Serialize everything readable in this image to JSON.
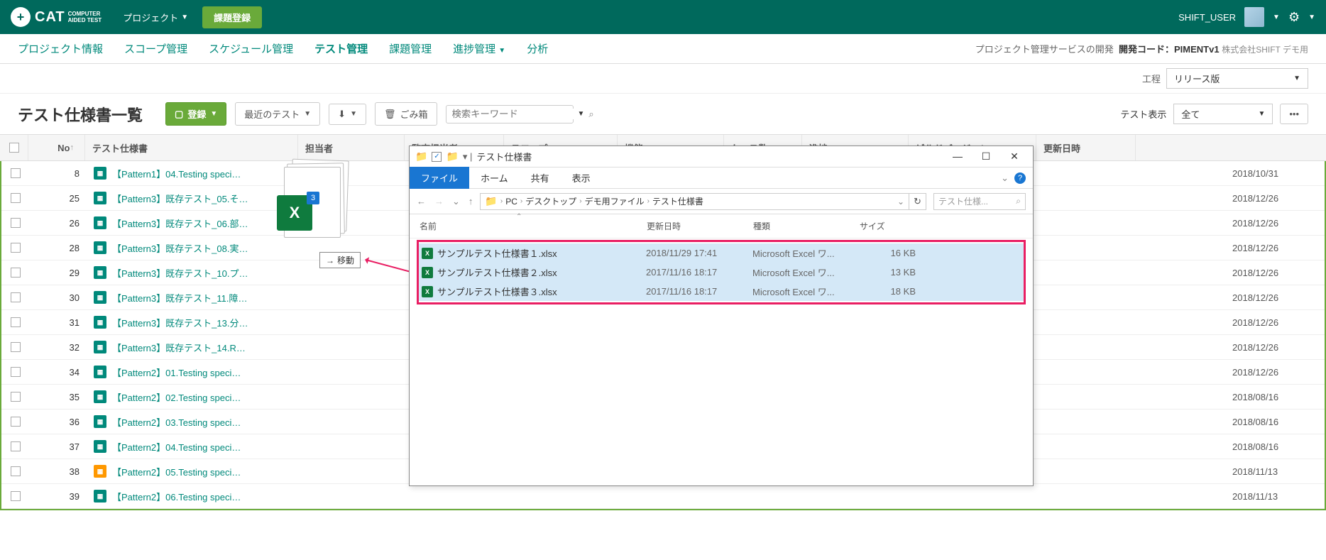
{
  "topbar": {
    "logo_main": "CAT",
    "logo_sub1": "COMPUTER",
    "logo_sub2": "AIDED TEST",
    "project_menu": "プロジェクト",
    "register_btn": "課題登録",
    "user": "SHIFT_USER"
  },
  "subnav": {
    "items": [
      "プロジェクト情報",
      "スコープ管理",
      "スケジュール管理",
      "テスト管理",
      "課題管理",
      "進捗管理",
      "分析"
    ],
    "dropdown_idx": 5,
    "active_idx": 3,
    "right_label": "プロジェクト管理サービスの開発",
    "dev_code_label": "開発コード：",
    "dev_code": "PIMENTv1",
    "company": "株式会社SHIFT デモ用"
  },
  "filter": {
    "label": "工程",
    "value": "リリース版"
  },
  "page": {
    "title": "テスト仕様書一覧",
    "register_btn": "登録",
    "recent_btn": "最近のテスト",
    "trash_btn": "ごみ箱",
    "search_placeholder": "検索キーワード",
    "display_label": "テスト表示",
    "display_value": "全て"
  },
  "columns": {
    "no": "No",
    "name": "テスト仕様書",
    "assign": "担当者",
    "audit": "監査担当者",
    "scope": "スコープ",
    "func": "機能",
    "cases": "ケース数",
    "progress": "進捗",
    "build": "ビルドバージョン",
    "date": "更新日時"
  },
  "rows": [
    {
      "no": 8,
      "name": "【Pattern1】04.Testing speci…",
      "date": "2018/10/31"
    },
    {
      "no": 25,
      "name": "【Pattern3】既存テスト_05.そ…",
      "date": "2018/12/26"
    },
    {
      "no": 26,
      "name": "【Pattern3】既存テスト_06.部…",
      "date": "2018/12/26"
    },
    {
      "no": 28,
      "name": "【Pattern3】既存テスト_08.実…",
      "date": "2018/12/26"
    },
    {
      "no": 29,
      "name": "【Pattern3】既存テスト_10.プ…",
      "date": "2018/12/26"
    },
    {
      "no": 30,
      "name": "【Pattern3】既存テスト_11.障…",
      "date": "2018/12/26"
    },
    {
      "no": 31,
      "name": "【Pattern3】既存テスト_13.分…",
      "date": "2018/12/26"
    },
    {
      "no": 32,
      "name": "【Pattern3】既存テスト_14.R…",
      "date": "2018/12/26"
    },
    {
      "no": 34,
      "name": "【Pattern2】01.Testing speci…",
      "date": "2018/12/26"
    },
    {
      "no": 35,
      "name": "【Pattern2】02.Testing speci…",
      "date": "2018/08/16"
    },
    {
      "no": 36,
      "name": "【Pattern2】03.Testing speci…",
      "date": "2018/08/16"
    },
    {
      "no": 37,
      "name": "【Pattern2】04.Testing speci…",
      "date": "2018/08/16"
    },
    {
      "no": 38,
      "name": "【Pattern2】05.Testing speci…",
      "date": "2018/11/13",
      "orange": true
    },
    {
      "no": 39,
      "name": "【Pattern2】06.Testing speci…",
      "date": "2018/11/13"
    }
  ],
  "explorer": {
    "title": "テスト仕様書",
    "tabs": {
      "file": "ファイル",
      "home": "ホーム",
      "share": "共有",
      "view": "表示"
    },
    "breadcrumb": [
      "PC",
      "デスクトップ",
      "デモ用ファイル",
      "テスト仕様書"
    ],
    "search_placeholder": "テスト仕様...",
    "cols": {
      "name": "名前",
      "date": "更新日時",
      "type": "種類",
      "size": "サイズ"
    },
    "files": [
      {
        "name": "サンプルテスト仕様書１.xlsx",
        "date": "2018/11/29 17:41",
        "type": "Microsoft Excel ワ...",
        "size": "16 KB"
      },
      {
        "name": "サンプルテスト仕様書２.xlsx",
        "date": "2017/11/16 18:17",
        "type": "Microsoft Excel ワ...",
        "size": "13 KB"
      },
      {
        "name": "サンプルテスト仕様書３.xlsx",
        "date": "2017/11/16 18:17",
        "type": "Microsoft Excel ワ...",
        "size": "18 KB"
      }
    ]
  },
  "drag": {
    "count": "3",
    "move_label": "移動"
  }
}
